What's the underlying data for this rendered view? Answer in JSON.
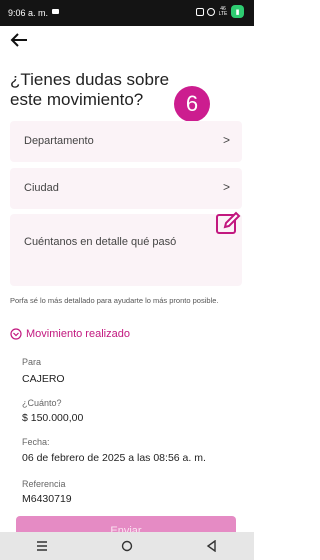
{
  "status_bar": {
    "time": "9:06 a. m.",
    "network_label": "46 LTE",
    "battery_icon": "battery-icon"
  },
  "header": {
    "back_icon": "arrow-left-icon",
    "title": "¿Tienes dudas sobre este movimiento?",
    "step_number": "6",
    "accent_color": "#cc1d8f"
  },
  "form": {
    "department_label": "Departamento",
    "city_label": "Ciudad",
    "detail_placeholder": "Cuéntanos en detalle qué pasó",
    "helper_text": "Porfa sé lo más detallado para ayudarte lo más pronto posible.",
    "field_background": "#fbf3f7"
  },
  "movement": {
    "section_title": "Movimiento realizado",
    "to_label": "Para",
    "to_value": "CAJERO",
    "amount_label": "¿Cuánto?",
    "amount_value": "$ 150.000,00",
    "date_label": "Fecha:",
    "date_value": "06 de febrero de 2025 a las 08:56 a. m.",
    "reference_label": "Referencia",
    "reference_value": "M6430719"
  },
  "footer": {
    "continue_label": "Enviar"
  },
  "nav_bar": {
    "icons": [
      "menu-icon",
      "home-circle-icon",
      "back-triangle-icon"
    ]
  }
}
